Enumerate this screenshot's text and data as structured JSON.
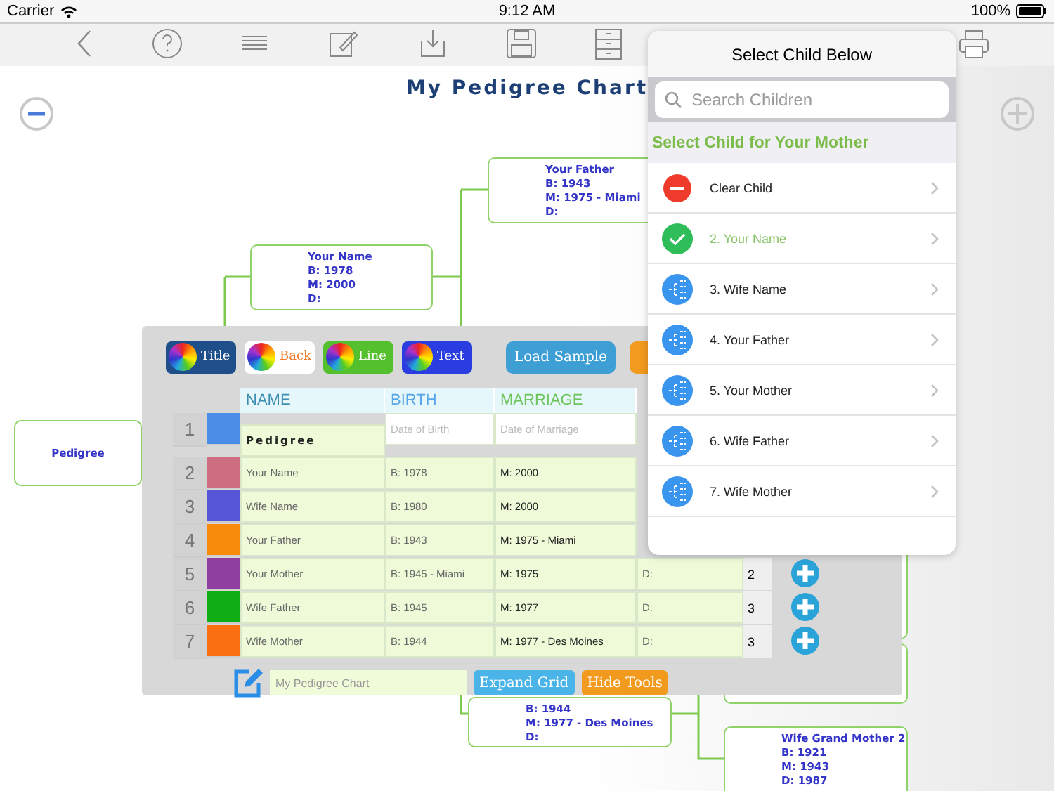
{
  "status_bar": {
    "carrier": "Carrier",
    "time": "9:12 AM",
    "battery": "100%"
  },
  "chart": {
    "title": "My Pedigree Chart",
    "nodes": [
      {
        "name": "Pedigree"
      },
      {
        "name": "Your Name",
        "lines": [
          "B: 1978",
          "M: 2000",
          "D:"
        ]
      },
      {
        "name": "Your Father",
        "lines": [
          "B: 1943",
          "M: 1975 - Miami",
          "D:"
        ]
      },
      {
        "lines": [
          "B: 1944",
          "M: 1977 - Des Moines",
          "D:"
        ]
      },
      {
        "name": "Wife Grand Mother 2",
        "lines": [
          "B: 1921",
          "M: 1943",
          "D: 1987"
        ]
      }
    ]
  },
  "tools": {
    "color_buttons": [
      {
        "label": "Title",
        "kind": "dark"
      },
      {
        "label": "Back",
        "kind": "white"
      },
      {
        "label": "Line",
        "kind": "green"
      },
      {
        "label": "Text",
        "kind": "blue"
      }
    ],
    "load_button": "Load Sample",
    "columns": [
      {
        "label": "NAME",
        "color": "#3d8fb0"
      },
      {
        "label": "BIRTH",
        "color": "#58a6e8"
      },
      {
        "label": "MARRIAGE",
        "color": "#6cc45a"
      }
    ],
    "rows": [
      {
        "index": "1",
        "color": "#4a8ee8",
        "kind": "title",
        "name": "Pedigree",
        "birth": "Date of Birth",
        "marriage": "Date of Marriage"
      },
      {
        "index": "2",
        "color": "#cf6d82",
        "kind": "person",
        "name": "Your Name",
        "birth": "B: 1978",
        "marriage": "M: 2000"
      },
      {
        "index": "3",
        "color": "#5656d6",
        "kind": "person",
        "name": "Wife Name",
        "birth": "B: 1980",
        "marriage": "M: 2000"
      },
      {
        "index": "4",
        "color": "#f98b0c",
        "kind": "person",
        "name": "Your Father",
        "birth": "B: 1943",
        "marriage": "M: 1975 - Miami"
      },
      {
        "index": "5",
        "color": "#8e3fa0",
        "kind": "person",
        "name": "Your Mother",
        "birth": "B: 1945 - Miami",
        "marriage": "M: 1975",
        "death": "D:",
        "count": "2"
      },
      {
        "index": "6",
        "color": "#11ad14",
        "kind": "person",
        "name": "Wife Father",
        "birth": "B: 1945",
        "marriage": "M: 1977",
        "death": "D:",
        "count": "3"
      },
      {
        "index": "7",
        "color": "#f96f12",
        "kind": "person",
        "name": "Wife Mother",
        "birth": "B: 1944",
        "marriage": "M: 1977 - Des Moines",
        "death": "D:",
        "count": "3"
      }
    ],
    "title_field": {
      "placeholder": "My Pedigree Chart"
    },
    "expand_button": "Expand Grid",
    "hide_button": "Hide Tools"
  },
  "popover": {
    "title": "Select Child Below",
    "search": {
      "placeholder": "Search Children"
    },
    "section": "Select Child for Your Mother",
    "items": [
      {
        "label": "Clear Child",
        "kind": "clear",
        "selected": false
      },
      {
        "label": "2. Your Name",
        "kind": "person",
        "selected": true
      },
      {
        "label": "3. Wife Name",
        "kind": "person",
        "selected": false
      },
      {
        "label": "4. Your Father",
        "kind": "person",
        "selected": false
      },
      {
        "label": "5. Your Mother",
        "kind": "person",
        "selected": false
      },
      {
        "label": "6. Wife Father",
        "kind": "person",
        "selected": false
      },
      {
        "label": "7. Wife Mother",
        "kind": "person",
        "selected": false
      }
    ]
  }
}
